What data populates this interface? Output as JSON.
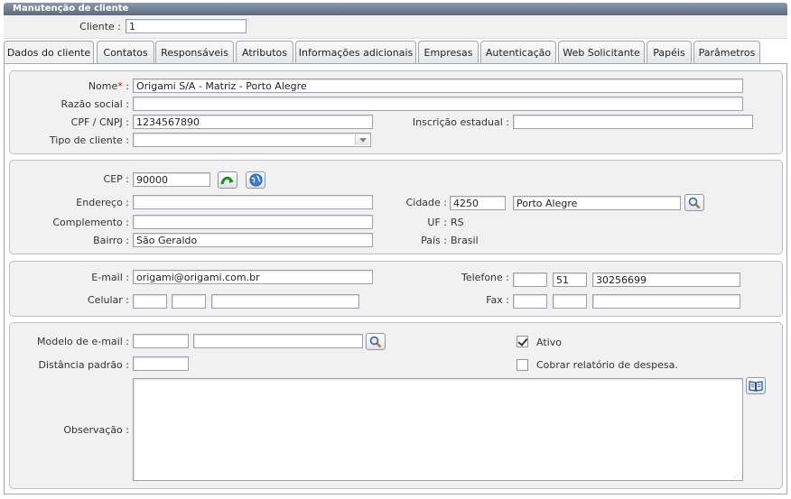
{
  "window": {
    "title": "Manutenção de cliente"
  },
  "header": {
    "cliente_label": "Cliente :",
    "cliente_value": "1"
  },
  "tabs": [
    {
      "label": "Dados do cliente"
    },
    {
      "label": "Contatos"
    },
    {
      "label": "Responsáveis"
    },
    {
      "label": "Atributos"
    },
    {
      "label": "Informações adicionais"
    },
    {
      "label": "Empresas"
    },
    {
      "label": "Autenticação"
    },
    {
      "label": "Web Solicitante"
    },
    {
      "label": "Papéis"
    },
    {
      "label": "Parâmetros"
    }
  ],
  "identificacao": {
    "nome_label": "Nome",
    "nome_required": "*",
    "nome_colon": ":",
    "nome_value": "Origami S/A - Matriz - Porto Alegre",
    "razao_label": "Razão social :",
    "razao_value": "",
    "cpf_label": "CPF / CNPJ :",
    "cpf_value": "1234567890",
    "ie_label": "Inscrição estadual :",
    "ie_value": "",
    "tipo_label": "Tipo de cliente :",
    "tipo_value": ""
  },
  "endereco": {
    "cep_label": "CEP :",
    "cep_value": "90000",
    "endereco_label": "Endereço :",
    "endereco_value": "",
    "cidade_label": "Cidade :",
    "cidade_code": "4250",
    "cidade_name": "Porto Alegre",
    "complemento_label": "Complemento :",
    "complemento_value": "",
    "uf_label": "UF :",
    "uf_value": "RS",
    "bairro_label": "Bairro :",
    "bairro_value": "São Geraldo",
    "pais_label": "País :",
    "pais_value": "Brasil"
  },
  "contato": {
    "email_label": "E-mail :",
    "email_value": "origami@origami.com.br",
    "telefone_label": "Telefone :",
    "telefone_country": "",
    "telefone_ddd": "51",
    "telefone_number": "30256699",
    "celular_label": "Celular :",
    "celular_country": "",
    "celular_ddd": "",
    "celular_number": "",
    "fax_label": "Fax :",
    "fax_country": "",
    "fax_ddd": "",
    "fax_number": ""
  },
  "outros": {
    "modelo_label": "Modelo de e-mail :",
    "modelo_code": "",
    "modelo_name": "",
    "ativo_label": "Ativo",
    "ativo_checked": true,
    "distancia_label": "Distância padrão :",
    "distancia_value": "",
    "cobrar_label": "Cobrar relatório de despesa.",
    "cobrar_checked": false,
    "observacao_label": "Observação :",
    "observacao_value": ""
  },
  "icons": {
    "cep_search": "green-arrow-icon",
    "cep_web": "globe-icon",
    "cidade_search": "magnifier-icon",
    "modelo_search": "magnifier-icon",
    "observacao_book": "book-icon"
  },
  "colors": {
    "titlebar": "#5d6b80",
    "panel": "#f1f1f1",
    "border": "#9ea6b2",
    "required": "#dd0000"
  }
}
